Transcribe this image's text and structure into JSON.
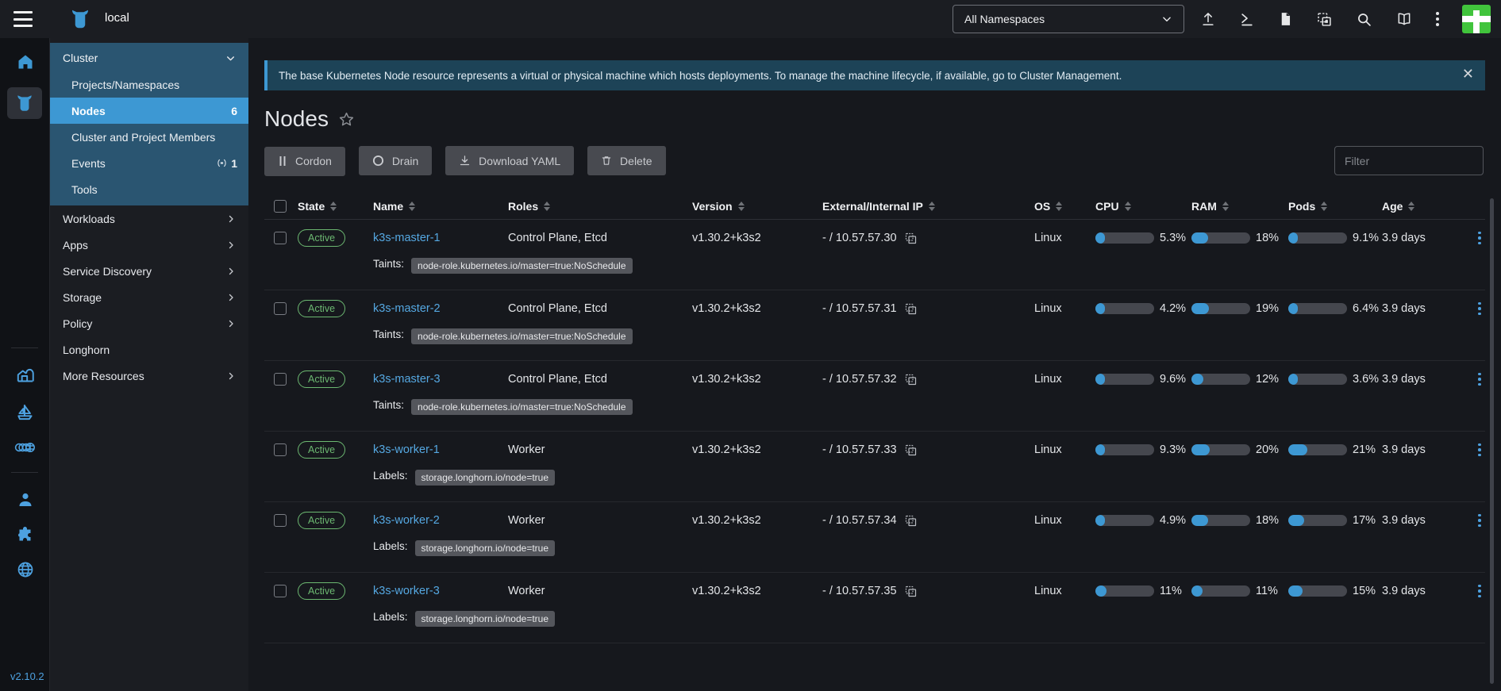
{
  "app": {
    "version": "v2.10.2"
  },
  "header": {
    "cluster_name": "local",
    "namespace_selector": "All Namespaces",
    "icons": [
      "upload-icon",
      "kubectl-shell-icon",
      "yaml-file-icon",
      "import-yaml-icon",
      "search-icon",
      "docs-icon",
      "kebab-menu-icon",
      "user-avatar"
    ]
  },
  "rail": {
    "top_icons": [
      "home-icon",
      "cluster-local-icon"
    ],
    "middle_icons": [
      "harvester-icon",
      "fleet-icon",
      "cluster-management-icon"
    ],
    "bottom_icons": [
      "user-icon",
      "extensions-icon",
      "locale-icon"
    ]
  },
  "sidebar": {
    "cluster_group": {
      "label": "Cluster",
      "items": [
        {
          "label": "Projects/Namespaces"
        },
        {
          "label": "Nodes",
          "count": "6",
          "active": true
        },
        {
          "label": "Cluster and Project Members"
        },
        {
          "label": "Events",
          "badge_count": "1"
        },
        {
          "label": "Tools"
        }
      ]
    },
    "groups": [
      {
        "label": "Workloads",
        "expandable": true
      },
      {
        "label": "Apps",
        "expandable": true
      },
      {
        "label": "Service Discovery",
        "expandable": true
      },
      {
        "label": "Storage",
        "expandable": true
      },
      {
        "label": "Policy",
        "expandable": true
      },
      {
        "label": "Longhorn",
        "expandable": false
      },
      {
        "label": "More Resources",
        "expandable": true
      }
    ]
  },
  "banner": {
    "text": "The base Kubernetes Node resource represents a virtual or physical machine which hosts deployments. To manage the machine lifecycle, if available, go to Cluster Management."
  },
  "page": {
    "title": "Nodes"
  },
  "toolbar": {
    "cordon": "Cordon",
    "drain": "Drain",
    "download_yaml": "Download YAML",
    "delete": "Delete",
    "filter_placeholder": "Filter"
  },
  "table": {
    "headers": [
      "State",
      "Name",
      "Roles",
      "Version",
      "External/Internal IP",
      "OS",
      "CPU",
      "RAM",
      "Pods",
      "Age"
    ],
    "rows": [
      {
        "state": "Active",
        "name": "k3s-master-1",
        "roles": "Control Plane, Etcd",
        "version": "v1.30.2+k3s2",
        "ip": "- / 10.57.57.30",
        "os": "Linux",
        "cpu_pct": 5.3,
        "cpu": "5.3%",
        "ram_pct": 18,
        "ram": "18%",
        "pods_pct": 9.1,
        "pods": "9.1%",
        "age": "3.9 days",
        "meta_key": "Taints:",
        "meta_value": "node-role.kubernetes.io/master=true:NoSchedule"
      },
      {
        "state": "Active",
        "name": "k3s-master-2",
        "roles": "Control Plane, Etcd",
        "version": "v1.30.2+k3s2",
        "ip": "- / 10.57.57.31",
        "os": "Linux",
        "cpu_pct": 4.2,
        "cpu": "4.2%",
        "ram_pct": 19,
        "ram": "19%",
        "pods_pct": 6.4,
        "pods": "6.4%",
        "age": "3.9 days",
        "meta_key": "Taints:",
        "meta_value": "node-role.kubernetes.io/master=true:NoSchedule"
      },
      {
        "state": "Active",
        "name": "k3s-master-3",
        "roles": "Control Plane, Etcd",
        "version": "v1.30.2+k3s2",
        "ip": "- / 10.57.57.32",
        "os": "Linux",
        "cpu_pct": 9.6,
        "cpu": "9.6%",
        "ram_pct": 12,
        "ram": "12%",
        "pods_pct": 3.6,
        "pods": "3.6%",
        "age": "3.9 days",
        "meta_key": "Taints:",
        "meta_value": "node-role.kubernetes.io/master=true:NoSchedule"
      },
      {
        "state": "Active",
        "name": "k3s-worker-1",
        "roles": "Worker",
        "version": "v1.30.2+k3s2",
        "ip": "- / 10.57.57.33",
        "os": "Linux",
        "cpu_pct": 9.3,
        "cpu": "9.3%",
        "ram_pct": 20,
        "ram": "20%",
        "pods_pct": 21,
        "pods": "21%",
        "age": "3.9 days",
        "meta_key": "Labels:",
        "meta_value": "storage.longhorn.io/node=true"
      },
      {
        "state": "Active",
        "name": "k3s-worker-2",
        "roles": "Worker",
        "version": "v1.30.2+k3s2",
        "ip": "- / 10.57.57.34",
        "os": "Linux",
        "cpu_pct": 4.9,
        "cpu": "4.9%",
        "ram_pct": 18,
        "ram": "18%",
        "pods_pct": 17,
        "pods": "17%",
        "age": "3.9 days",
        "meta_key": "Labels:",
        "meta_value": "storage.longhorn.io/node=true"
      },
      {
        "state": "Active",
        "name": "k3s-worker-3",
        "roles": "Worker",
        "version": "v1.30.2+k3s2",
        "ip": "- / 10.57.57.35",
        "os": "Linux",
        "cpu_pct": 11,
        "cpu": "11%",
        "ram_pct": 11,
        "ram": "11%",
        "pods_pct": 15,
        "pods": "15%",
        "age": "3.9 days",
        "meta_key": "Labels:",
        "meta_value": "storage.longhorn.io/node=true"
      }
    ]
  }
}
